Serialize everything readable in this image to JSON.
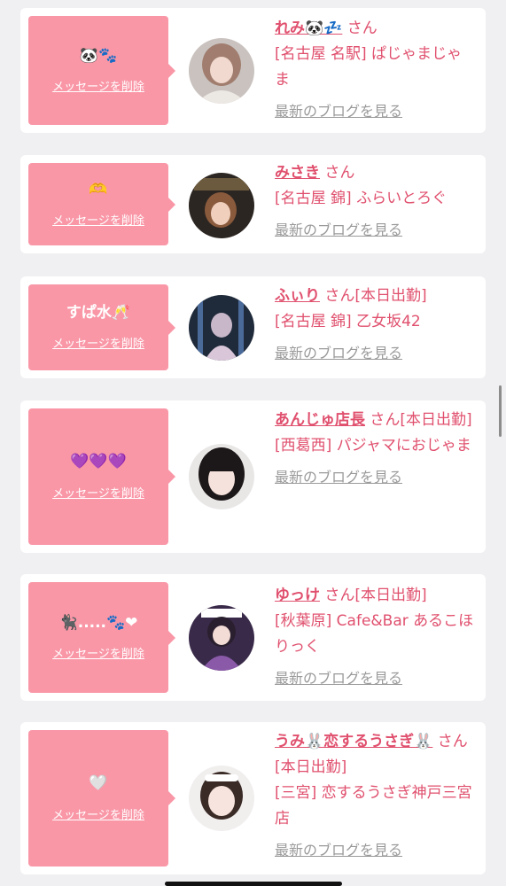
{
  "delete_label": "メッセージを削除",
  "blog_label": "最新のブログを見る",
  "honorific": "さん",
  "working_today": "[本日出勤]",
  "colors": {
    "bubble": "#f997a7",
    "name": "#e0506e",
    "link_gray": "#9a9a9a",
    "page_bg": "#f0f0f2"
  },
  "cards": [
    {
      "message": "🐼🐾",
      "name": "れみ🐼💤",
      "status": "",
      "location": "[名古屋 名駅] ぱじゃまじゃま",
      "avatar_icon": "profile-photo-icon"
    },
    {
      "message": "🫶",
      "name": "みさき",
      "status": "",
      "location": "[名古屋 錦] ふらいとろぐ",
      "avatar_icon": "profile-photo-icon"
    },
    {
      "message": "すぱ水🥂",
      "name": "ふぃり",
      "status": "[本日出勤]",
      "location": "[名古屋 錦] 乙女坂42",
      "avatar_icon": "profile-photo-icon"
    },
    {
      "message": "💜💜💜",
      "name": "あんじゅ店長",
      "status": "[本日出勤]",
      "location": "[西葛西] パジャマにおじゃま",
      "avatar_icon": "profile-photo-icon"
    },
    {
      "message": "🐈‍⬛.....🐾❤",
      "name": "ゆっけ",
      "status": "[本日出勤]",
      "location": "[秋葉原] Cafe&Bar あるこほりっく",
      "avatar_icon": "profile-photo-icon"
    },
    {
      "message": "🤍",
      "name": "うみ🐰恋するうさぎ🐰",
      "status": "[本日出勤]",
      "location": "[三宮] 恋するうさぎ神戸三宮店",
      "avatar_icon": "profile-photo-icon"
    }
  ]
}
